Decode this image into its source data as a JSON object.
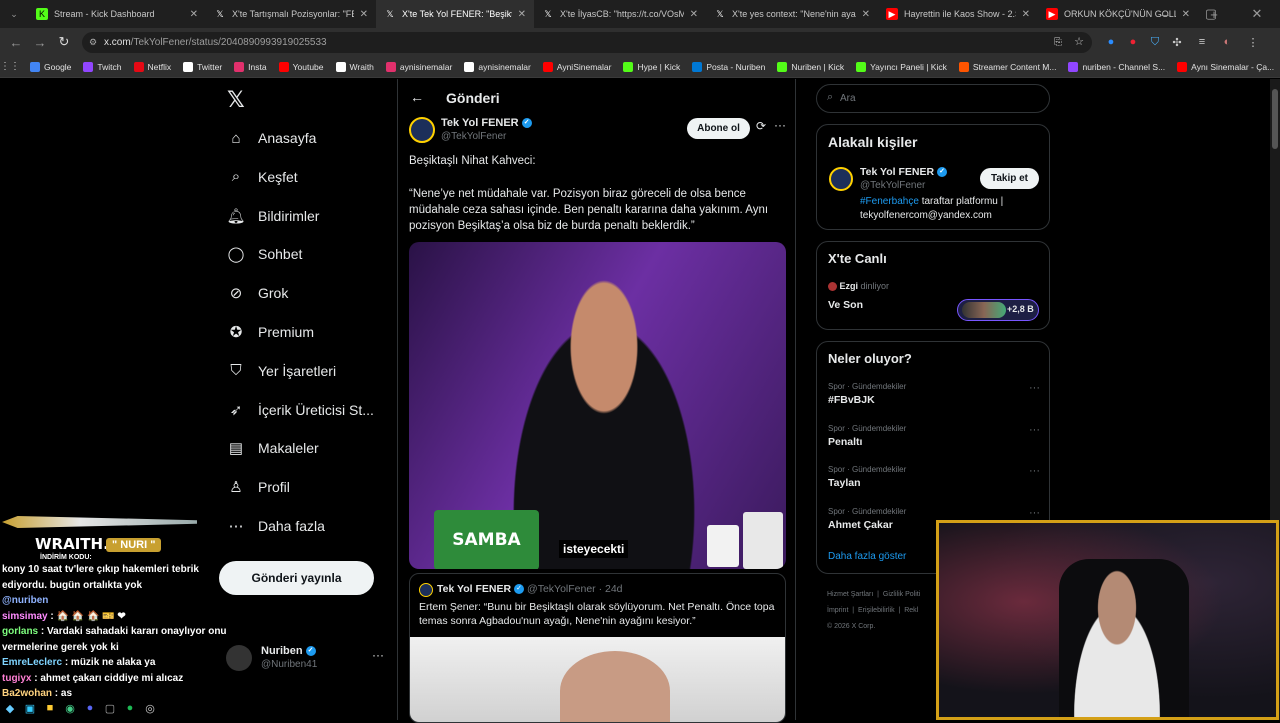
{
  "tabs": [
    {
      "title": "Stream - Kick Dashboard",
      "icon": "kick-icon",
      "color": "#53fc18"
    },
    {
      "title": "X'te Tartışmalı Pozisyonlar: \"FB",
      "icon": "x-icon",
      "color": "#ffffff"
    },
    {
      "title": "X'te Tek Yol FENER: \"Beşikta",
      "icon": "x-icon",
      "color": "#ffffff"
    },
    {
      "title": "X'te İlyasCB: \"https://t.co/VOsM",
      "icon": "x-icon",
      "color": "#ffffff"
    },
    {
      "title": "X'te yes context: \"Nene'nin aya",
      "icon": "x-icon",
      "color": "#ffffff"
    },
    {
      "title": "Hayrettin ile Kaos Show - 2.Sez",
      "icon": "youtube-icon",
      "color": "#ff0000"
    },
    {
      "title": "ORKUN KÖKÇÜ'NÜN GOLLERİ",
      "icon": "youtube-icon",
      "color": "#ff0000"
    }
  ],
  "url": {
    "host": "x.com",
    "path": "/TekYolFener/status/2040890993919025533"
  },
  "bookmarks": [
    {
      "label": "Google",
      "color": "#4285f4"
    },
    {
      "label": "Twitch",
      "color": "#9146ff"
    },
    {
      "label": "Netflix",
      "color": "#e50914"
    },
    {
      "label": "Twitter",
      "color": "#ffffff"
    },
    {
      "label": "Insta",
      "color": "#e1306c"
    },
    {
      "label": "Youtube",
      "color": "#ff0000"
    },
    {
      "label": "Wraith",
      "color": "#ffffff"
    },
    {
      "label": "aynisinemalar",
      "color": "#e1306c"
    },
    {
      "label": "aynisinemalar",
      "color": "#ffffff"
    },
    {
      "label": "AyniSinemalar",
      "color": "#ff0000"
    },
    {
      "label": "Hype | Kick",
      "color": "#53fc18"
    },
    {
      "label": "Posta - Nuriben",
      "color": "#0078d4"
    },
    {
      "label": "Nuriben | Kick",
      "color": "#53fc18"
    },
    {
      "label": "Yayıncı Paneli | Kick",
      "color": "#53fc18"
    },
    {
      "label": "Streamer Content M...",
      "color": "#ff5500"
    },
    {
      "label": "nuriben - Channel S...",
      "color": "#9146ff"
    },
    {
      "label": "Aynı Sinemalar - Ça...",
      "color": "#ff0000"
    }
  ],
  "nav": [
    {
      "label": "Anasayfa",
      "icon": "home-icon"
    },
    {
      "label": "Keşfet",
      "icon": "search-icon"
    },
    {
      "label": "Bildirimler",
      "icon": "bell-icon"
    },
    {
      "label": "Sohbet",
      "icon": "chat-icon"
    },
    {
      "label": "Grok",
      "icon": "grok-icon"
    },
    {
      "label": "Premium",
      "icon": "premium-icon"
    },
    {
      "label": "Yer İşaretleri",
      "icon": "bookmark-icon"
    },
    {
      "label": "İçerik Üreticisi St...",
      "icon": "rocket-icon"
    },
    {
      "label": "Makaleler",
      "icon": "article-icon"
    },
    {
      "label": "Profil",
      "icon": "user-icon"
    },
    {
      "label": "Daha fazla",
      "icon": "more-icon"
    }
  ],
  "post_button": "Gönderi yayınla",
  "account": {
    "name": "Nuriben",
    "handle": "@Nuriben41"
  },
  "header": {
    "title": "Gönderi"
  },
  "post": {
    "author": "Tek Yol FENER",
    "handle": "@TekYolFener",
    "follow_label": "Abone ol",
    "line1": "Beşiktaşlı Nihat Kahveci:",
    "body": "“Nene’ye net müdahale var. Pozisyon biraz göreceli de olsa bence müdahale ceza sahası içinde. Ben penaltı kararına daha yakınım. Aynı pozisyon Beşiktaş’a olsa biz de burda penaltı beklerdik.”",
    "video_caption": "isteyecekti"
  },
  "quote": {
    "author": "Tek Yol FENER",
    "handle": "@TekYolFener",
    "age": "· 24d",
    "body": "Ertem Şener: “Bunu bir Beşiktaşlı olarak söylüyorum. Net Penaltı. Önce topa temas sonra Agbadou'nun ayağı, Nene'nin ayağını kesiyor.”"
  },
  "search_placeholder": "Ara",
  "related": {
    "title": "Alakalı kişiler",
    "name": "Tek Yol FENER",
    "handle": "@TekYolFener",
    "follow": "Takip et",
    "hashtag": "#Fenerbahçe",
    "bio": " taraftar platformu | tekyolfenercom@yandex.com"
  },
  "live": {
    "title": "X'te Canlı",
    "user": "Ezgi",
    "status": "dinliyor",
    "space": "Ve Son",
    "count": "+2,8 B"
  },
  "trends": {
    "title": "Neler oluyor?",
    "items": [
      {
        "meta": "Spor · Gündemdekiler",
        "name": "#FBvBJK"
      },
      {
        "meta": "Spor · Gündemdekiler",
        "name": "Penaltı"
      },
      {
        "meta": "Spor · Gündemdekiler",
        "name": "Taylan"
      },
      {
        "meta": "Spor · Gündemdekiler",
        "name": "Ahmet Çakar"
      }
    ],
    "more": "Daha fazla göster"
  },
  "footer": {
    "links": [
      "Hizmet Şartları",
      "Gizlilik Politi",
      "İmprint",
      "Erişilebilirlik",
      "Rekl"
    ],
    "copyright": "© 2026 X Corp."
  },
  "overlay": {
    "brand": "WRAITH.",
    "code_label": "İNDİRİM KODU:",
    "code": "\" NURI \"",
    "chat": [
      {
        "user": "kony",
        "color": "#ffffff",
        "text": "10 saat tv'lere çıkıp hakemleri tebrik ediyordu. bugün ortalıkta yok"
      },
      {
        "user": "",
        "color": "#8fb3ff",
        "text": "@nuriben"
      },
      {
        "user": "simsimay",
        "color": "#ff8cff",
        "text": ": 🏠 🏠 🏠 🎫 ❤"
      },
      {
        "user": "gorlans",
        "color": "#7fff7f",
        "text": ": Vardaki sahadaki kararı onaylıyor onu vermelerine gerek yok ki"
      },
      {
        "user": "EmreLeclerc",
        "color": "#7fd4ff",
        "text": ": müzik ne alaka ya"
      },
      {
        "user": "tugiyx",
        "color": "#ff7fd4",
        "text": ": ahmet çakarı ciddiye mi alıcaz"
      },
      {
        "user": "Ba2wohan",
        "color": "#ffd37f",
        "text": ": as"
      }
    ]
  }
}
